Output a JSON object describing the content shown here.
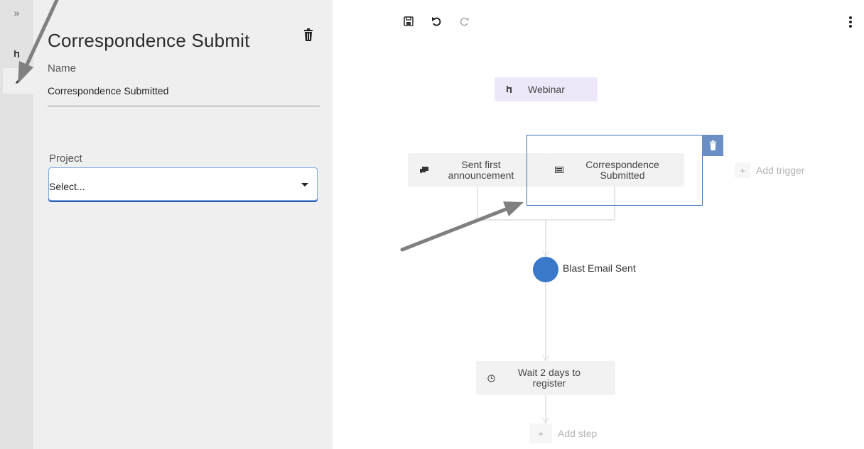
{
  "rail": {
    "expand_icon": "double-chevron-right-icon",
    "items": [
      {
        "icon": "trigger-icon"
      },
      {
        "icon": "pencil-icon"
      }
    ]
  },
  "panel": {
    "title": "Correspondence Submit",
    "delete_icon": "trash-icon",
    "name_label": "Name",
    "name_value": "Correspondence Submitted",
    "project_label": "Project",
    "project_selected": "Select..."
  },
  "toolbar": {
    "save_icon": "save-icon",
    "undo_icon": "undo-icon",
    "redo_icon": "redo-icon",
    "more_icon": "more-vertical-icon"
  },
  "canvas": {
    "campaign": "Webinar",
    "triggers": [
      {
        "label": "Sent first announcement",
        "icon": "chat-icon"
      },
      {
        "label": "Correspondence Submitted",
        "icon": "card-icon"
      }
    ],
    "add_trigger": "Add trigger",
    "event": "Blast Email Sent",
    "wait_step": "Wait 2 days to register",
    "wait_icon": "clock-icon",
    "add_step": "Add step"
  },
  "colors": {
    "accent": "#3a79c9",
    "selection": "#3a73b8",
    "campaign_bg": "#eee7fa",
    "annotation_arrow": "#808080"
  }
}
